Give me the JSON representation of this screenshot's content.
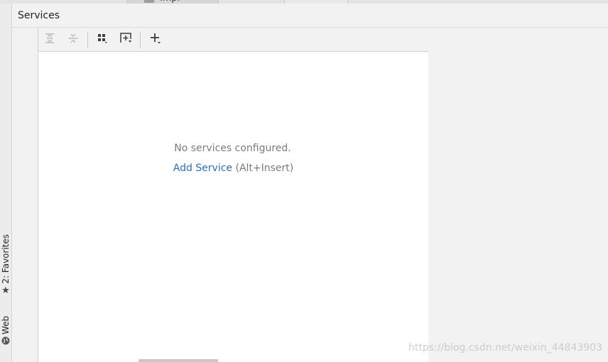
{
  "editor_tabs": {
    "tab1_label": "impl"
  },
  "left_tools": {
    "favorites_label": "2: Favorites",
    "favorites_icon": "star-icon",
    "web_label": "Web",
    "web_icon": "globe-icon"
  },
  "services": {
    "title": "Services",
    "toolbar": {
      "expand_all": "expand-all-icon",
      "collapse_all": "collapse-all-icon",
      "group_by": "group-by-icon",
      "new_tab": "open-in-new-tab-icon",
      "add": "add-icon"
    },
    "empty_message": "No services configured.",
    "add_service_link": "Add Service",
    "add_service_shortcut": "(Alt+Insert)"
  },
  "watermark": "https://blog.csdn.net/weixin_44843903",
  "colors": {
    "link": "#2f6fb2",
    "muted_text": "#7b7b7b",
    "panel_bg": "#ffffff",
    "chrome_bg": "#f2f2f2"
  }
}
